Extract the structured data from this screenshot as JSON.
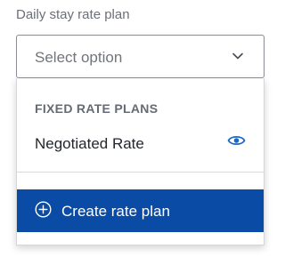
{
  "field": {
    "label": "Daily stay rate plan",
    "placeholder": "Select option",
    "chevron_icon": "chevron-down-icon"
  },
  "menu": {
    "group_header": "FIXED RATE PLANS",
    "options": [
      {
        "label": "Negotiated Rate",
        "icon": "eye-icon"
      }
    ],
    "create_button": {
      "label": "Create rate plan",
      "icon": "plus-circle-icon"
    }
  },
  "colors": {
    "accent": "#0a4ba6",
    "icon_blue": "#1669c9",
    "text": "#23262d",
    "muted": "#6b6f78"
  }
}
